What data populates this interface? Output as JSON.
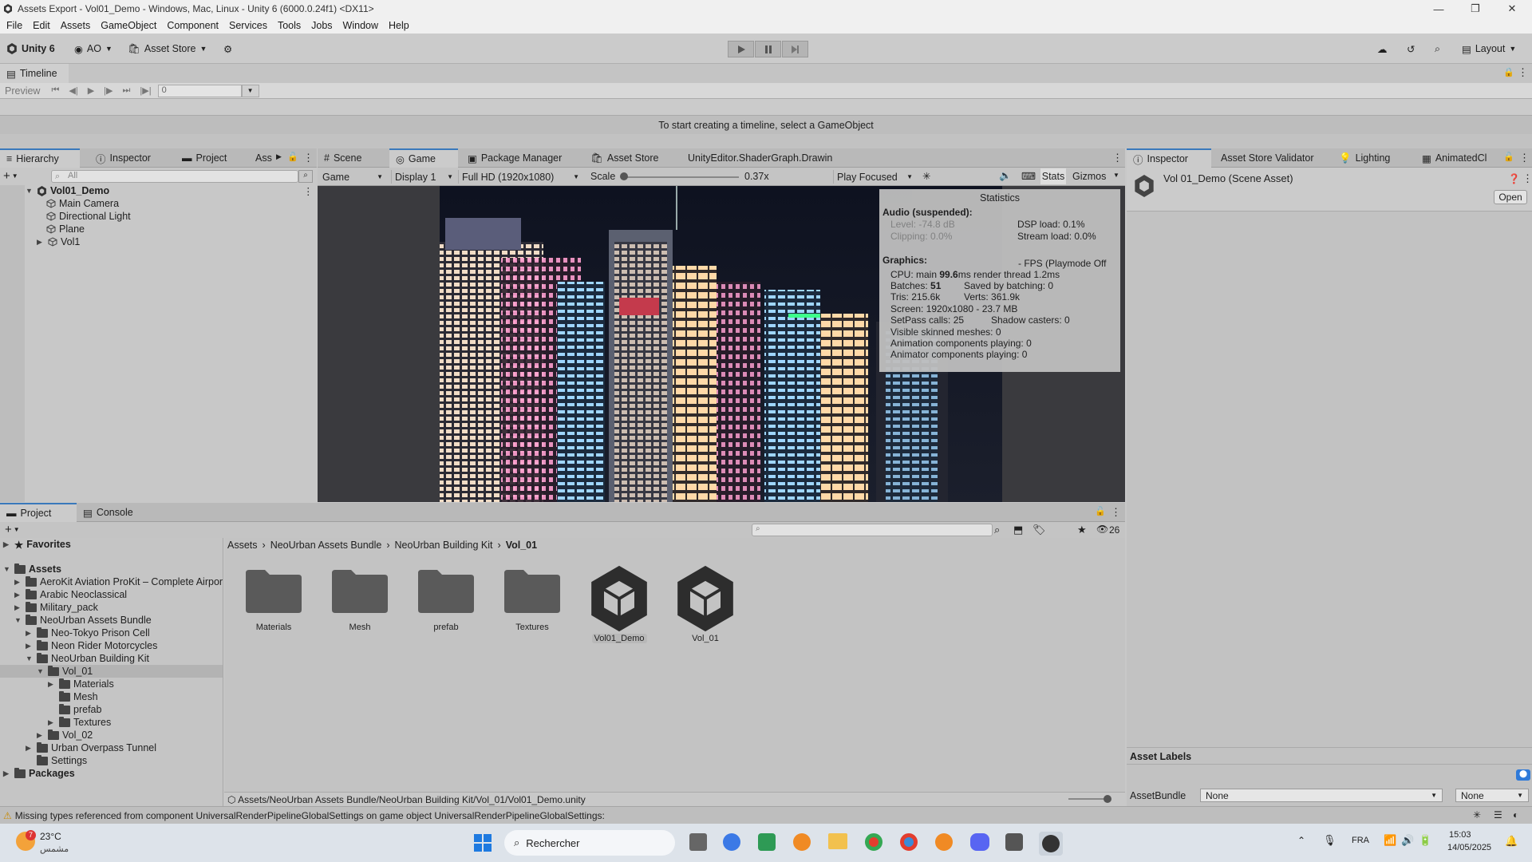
{
  "window": {
    "title": "Assets Export - Vol01_Demo - Windows, Mac, Linux - Unity 6 (6000.0.24f1) <DX11>"
  },
  "menu": [
    "File",
    "Edit",
    "Assets",
    "GameObject",
    "Component",
    "Services",
    "Tools",
    "Jobs",
    "Window",
    "Help"
  ],
  "toolbar": {
    "unity_label": "Unity 6",
    "account": "AO",
    "asset_store": "Asset Store",
    "layout": "Layout"
  },
  "timeline": {
    "tab": "Timeline",
    "preview": "Preview",
    "frame_value": "0",
    "message": "To start creating a timeline, select a GameObject"
  },
  "left_tabs": [
    "Hierarchy",
    "Inspector",
    "Project",
    "Ass"
  ],
  "hierarchy": {
    "search_placeholder": "All",
    "scene": "Vol01_Demo",
    "items": [
      "Main Camera",
      "Directional Light",
      "Plane",
      "Vol1"
    ]
  },
  "center_tabs": [
    "Scene",
    "Game",
    "Package Manager",
    "Asset Store",
    "UnityEditor.ShaderGraph.Drawin"
  ],
  "game_bar": {
    "mode": "Game",
    "display": "Display 1",
    "resolution": "Full HD (1920x1080)",
    "scale_label": "Scale",
    "scale_value": "0.37x",
    "play_mode": "Play Focused",
    "stats": "Stats",
    "gizmos": "Gizmos"
  },
  "stats": {
    "title": "Statistics",
    "audio_head": "Audio (suspended):",
    "level": "Level: -74.8 dB",
    "clipping": "Clipping: 0.0%",
    "dsp": "DSP load: 0.1%",
    "stream": "Stream load: 0.0%",
    "graphics_head": "Graphics:",
    "fps": "- FPS (Playmode Off",
    "cpu_pre": "CPU: main ",
    "cpu_val": "99.6",
    "cpu_post": "ms  render thread 1.2ms",
    "batches_pre": "Batches: ",
    "batches_val": "51",
    "saved": "Saved by batching: 0",
    "tris": "Tris: 215.6k",
    "verts": "Verts: 361.9k",
    "screen": "Screen: 1920x1080 - 23.7 MB",
    "setpass": "SetPass calls: 25",
    "shadow": "Shadow casters: 0",
    "skinned": "Visible skinned meshes: 0",
    "anim": "Animation components playing: 0",
    "animator": "Animator components playing: 0"
  },
  "right_tabs": [
    "Inspector",
    "Asset Store Validator",
    "Lighting",
    "AnimatedCl"
  ],
  "inspector": {
    "title": "Vol 01_Demo (Scene Asset)",
    "open": "Open",
    "asset_labels": "Asset Labels",
    "assetbundle_label": "AssetBundle",
    "assetbundle_value": "None",
    "variant_value": "None"
  },
  "bottom_tabs": [
    "Project",
    "Console"
  ],
  "project": {
    "favorites": "Favorites",
    "count": "26",
    "tree": [
      "Assets",
      "AeroKit Aviation ProKit – Complete Airpor",
      "Arabic Neoclassical",
      "Military_pack",
      "NeoUrban Assets Bundle",
      "Neo-Tokyo Prison Cell",
      "Neon Rider Motorcycles",
      "NeoUrban Building Kit",
      "Vol_01",
      "Materials",
      "Mesh",
      "prefab",
      "Textures",
      "Vol_02",
      "Urban Overpass Tunnel",
      "Settings",
      "Packages"
    ],
    "breadcrumb": [
      "Assets",
      "NeoUrban Assets Bundle",
      "NeoUrban Building Kit",
      "Vol_01"
    ],
    "items": [
      "Materials",
      "Mesh",
      "prefab",
      "Textures",
      "Vol01_Demo",
      "Vol_01"
    ],
    "path": "Assets/NeoUrban Assets Bundle/NeoUrban Building Kit/Vol_01/Vol01_Demo.unity"
  },
  "status": {
    "message": "Missing types referenced from component UniversalRenderPipelineGlobalSettings on game object UniversalRenderPipelineGlobalSettings:"
  },
  "taskbar": {
    "temp": "23°C",
    "weather": "مشمس",
    "search": "Rechercher",
    "lang": "FRA",
    "time": "15:03",
    "date": "14/05/2025",
    "badge": "7"
  }
}
